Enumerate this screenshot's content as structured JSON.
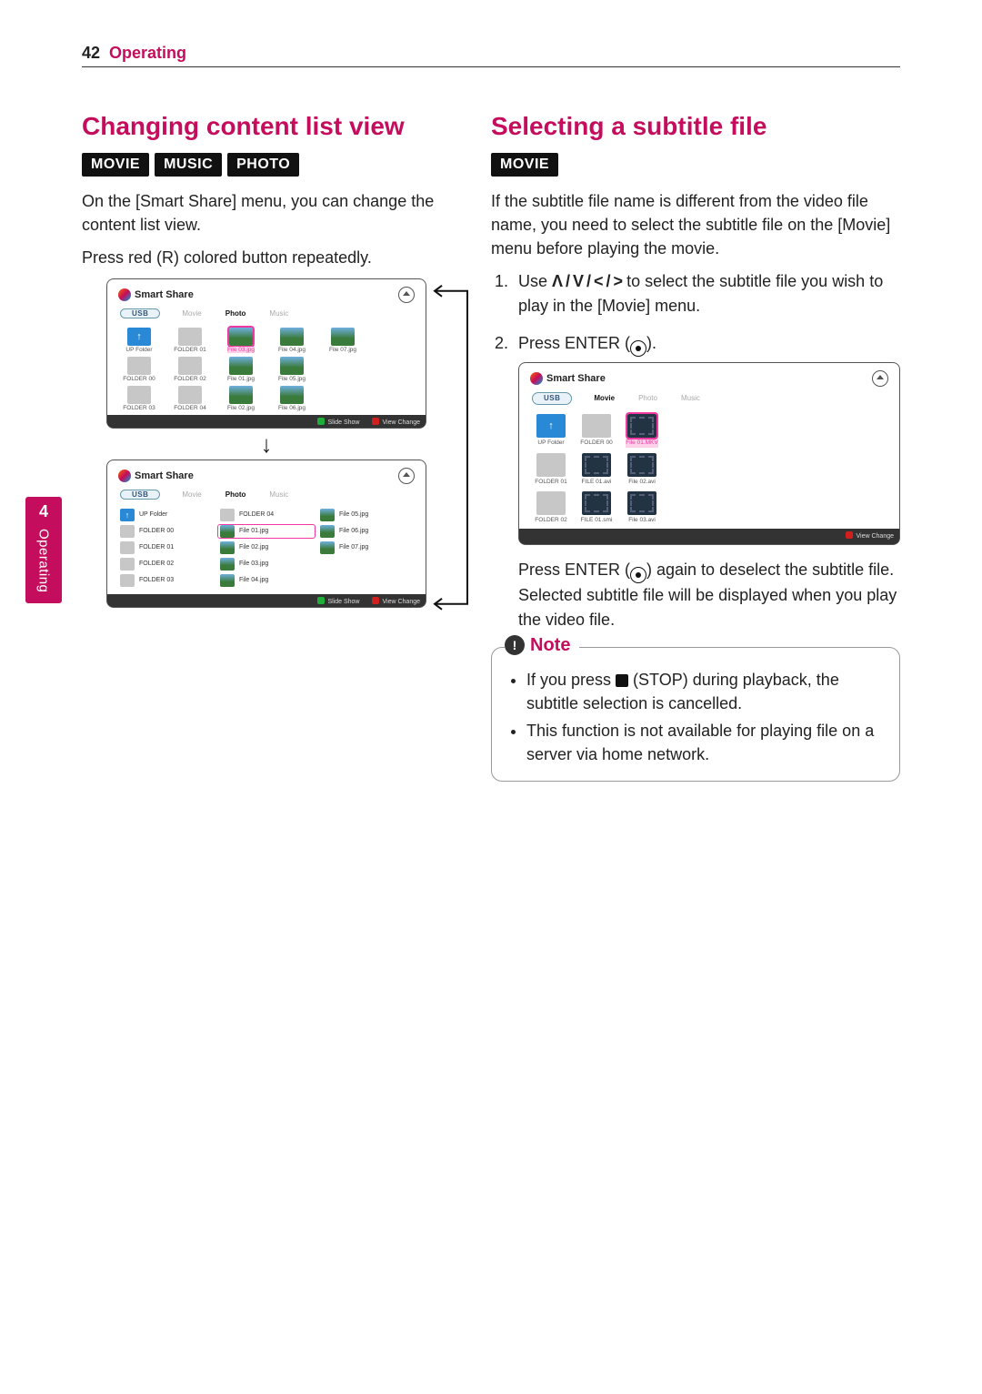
{
  "page": {
    "number": "42",
    "section": "Operating"
  },
  "sidetab": {
    "number": "4",
    "label": "Operating"
  },
  "left": {
    "heading": "Changing content list view",
    "modes": [
      "MOVIE",
      "MUSIC",
      "PHOTO"
    ],
    "para1": "On the [Smart Share] menu, you can change the content list view.",
    "para2": "Press red (R) colored button repeatedly."
  },
  "right": {
    "heading": "Selecting a subtitle file",
    "modes": [
      "MOVIE"
    ],
    "para1": "If the subtitle file name is different from the video file name, you need to select the subtitle file on the [Movie] menu before playing the movie.",
    "step1_pre": "Use ",
    "step1_glyph": "Λ / V / < / >",
    "step1_post": " to select the subtitle file you wish to play in the [Movie] menu.",
    "step2_pre": "Press ENTER (",
    "step2_post": ").",
    "after_shot_pre": "Press ENTER (",
    "after_shot_post": ") again to deselect the subtitle file. Selected subtitle file will be displayed when you play the video file.",
    "note_title": "Note",
    "note1_pre": "If you press ",
    "note1_post": " (STOP) during playback, the subtitle selection is cancelled.",
    "note2": "This function is not available for playing file on a server via home network."
  },
  "shots": {
    "title": "Smart Share",
    "usb": "USB",
    "tabs_photo": {
      "movie": "Movie",
      "photo": "Photo",
      "music": "Music",
      "active": "photo"
    },
    "tabs_movie": {
      "movie": "Movie",
      "photo": "Photo",
      "music": "Music",
      "active": "movie"
    },
    "foot_slide": "Slide Show",
    "foot_view": "View Change",
    "grid": {
      "items": [
        {
          "label": "UP Folder",
          "kind": "folder-up"
        },
        {
          "label": "FOLDER 01",
          "kind": "folder"
        },
        {
          "label": "File 03.jpg",
          "kind": "photo",
          "selected": true
        },
        {
          "label": "File 04.jpg",
          "kind": "photo"
        },
        {
          "label": "File 07.jpg",
          "kind": "photo"
        },
        {
          "label": "",
          "kind": "empty"
        },
        {
          "label": "FOLDER 00",
          "kind": "folder"
        },
        {
          "label": "FOLDER 02",
          "kind": "folder"
        },
        {
          "label": "File 01.jpg",
          "kind": "photo"
        },
        {
          "label": "File 05.jpg",
          "kind": "photo"
        },
        {
          "label": "",
          "kind": "empty"
        },
        {
          "label": "",
          "kind": "empty"
        },
        {
          "label": "FOLDER 03",
          "kind": "folder"
        },
        {
          "label": "FOLDER 04",
          "kind": "folder"
        },
        {
          "label": "File 02.jpg",
          "kind": "photo"
        },
        {
          "label": "File 06.jpg",
          "kind": "photo"
        },
        {
          "label": "",
          "kind": "empty"
        },
        {
          "label": "",
          "kind": "empty"
        }
      ]
    },
    "list": {
      "col1": [
        {
          "label": "UP Folder",
          "kind": "folder-up"
        },
        {
          "label": "FOLDER 00",
          "kind": "folder"
        },
        {
          "label": "FOLDER 01",
          "kind": "folder"
        },
        {
          "label": "FOLDER 02",
          "kind": "folder"
        },
        {
          "label": "FOLDER 03",
          "kind": "folder"
        }
      ],
      "col2": [
        {
          "label": "FOLDER 04",
          "kind": "folder"
        },
        {
          "label": "File 01.jpg",
          "kind": "photo",
          "selected": true
        },
        {
          "label": "File 02.jpg",
          "kind": "photo"
        },
        {
          "label": "File 03.jpg",
          "kind": "photo"
        },
        {
          "label": "File 04.jpg",
          "kind": "photo"
        }
      ],
      "col3": [
        {
          "label": "File 05.jpg",
          "kind": "photo"
        },
        {
          "label": "File 06.jpg",
          "kind": "photo"
        },
        {
          "label": "File 07.jpg",
          "kind": "photo"
        }
      ]
    },
    "movie_grid": {
      "items": [
        {
          "label": "UP Folder",
          "kind": "folder-up"
        },
        {
          "label": "FOLDER 00",
          "kind": "folder"
        },
        {
          "label": "File 01.MKV",
          "kind": "movie",
          "selected": true
        },
        {
          "label": "",
          "kind": "empty"
        },
        {
          "label": "FOLDER 01",
          "kind": "folder"
        },
        {
          "label": "FILE 01.avi",
          "kind": "movie"
        },
        {
          "label": "File 02.avi",
          "kind": "movie"
        },
        {
          "label": "",
          "kind": "empty"
        },
        {
          "label": "FOLDER 02",
          "kind": "folder"
        },
        {
          "label": "FILE 01.smi",
          "kind": "movie"
        },
        {
          "label": "File 03.avi",
          "kind": "movie"
        },
        {
          "label": "",
          "kind": "empty"
        }
      ]
    }
  }
}
